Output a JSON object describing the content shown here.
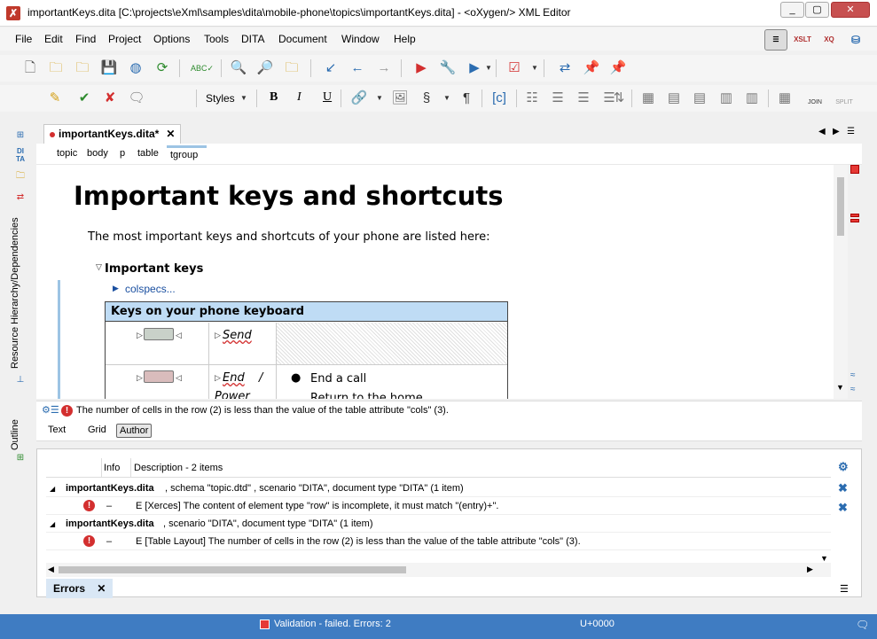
{
  "window": {
    "title": "importantKeys.dita [C:\\projects\\eXml\\samples\\dita\\mobile-phone\\topics\\importantKeys.dita] - <oXygen/> XML Editor",
    "minimize": "_",
    "maximize": "▢",
    "close": "✕"
  },
  "menu": [
    "File",
    "Edit",
    "Find",
    "Project",
    "Options",
    "Tools",
    "DITA",
    "Document",
    "Window",
    "Help"
  ],
  "perspectives": [
    "XSLT",
    "XQ"
  ],
  "toolbar2": {
    "styles_label": "Styles",
    "bold": "B",
    "italic": "I",
    "underline": "U",
    "join_label": "JOIN",
    "split_label": "SPLIT"
  },
  "sidebar": {
    "resource_tab": "Resource Hierarchy/Dependencies",
    "outline_tab": "Outline",
    "dita_icon": "DI TA"
  },
  "editor_tab": {
    "label": "importantKeys.dita*"
  },
  "breadcrumb": [
    "topic",
    "body",
    "p",
    "table",
    "tgroup"
  ],
  "document": {
    "title": "Important keys and shortcuts",
    "intro": "The most important keys and shortcuts of your phone are listed here:",
    "section_title": "Important keys",
    "colspecs": "colspecs...",
    "table_title": "Keys on your phone keyboard",
    "row1_key": "Send",
    "row2_key": "End",
    "row2_key_sep": "/",
    "row2_key2": "Power",
    "row2_item1": "End a call",
    "row2_item2": "Return to the home"
  },
  "message": "The number of cells in the row (2) is less than the value of the table attribute \"cols\" (3).",
  "mode_tabs": [
    "Text",
    "Grid",
    "Author"
  ],
  "errors": {
    "col_info": "Info",
    "col_desc": "Description - 2 items",
    "groups": [
      {
        "file": "importantKeys.dita",
        "detail": ", schema \"topic.dtd\" , scenario \"DITA\", document type \"DITA\" (1 item)",
        "message": "E [Xerces] The content of element type \"row\" is incomplete, it must match \"(entry)+\"."
      },
      {
        "file": "importantKeys.dita",
        "detail": ", scenario \"DITA\", document type \"DITA\" (1 item)",
        "message": "E [Table Layout] The number of cells in the row (2) is less than the value of the table attribute \"cols\" (3)."
      }
    ],
    "dash": "–",
    "tab_label": "Errors"
  },
  "status": {
    "validation": "Validation - failed. Errors: 2",
    "unicode": "U+0000"
  },
  "colors": {
    "accent": "#3f7cc2",
    "error": "#d32f2f",
    "table_head": "#bfdcf5"
  }
}
